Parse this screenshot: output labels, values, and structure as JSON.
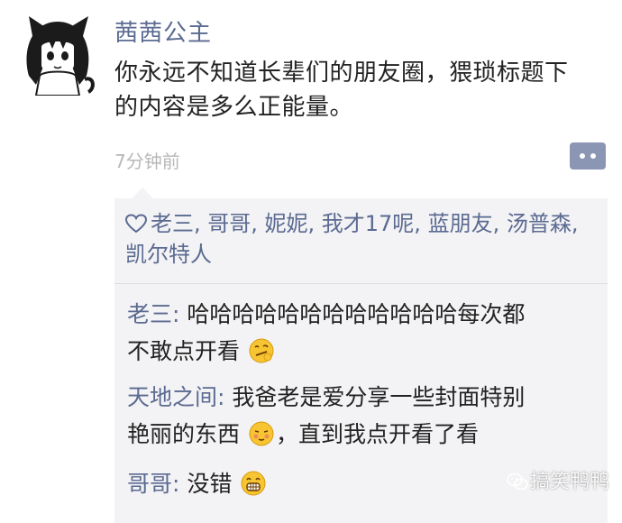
{
  "post": {
    "author": "茜茜公主",
    "text_line1": "你永远不知道长辈们的朋友圈，猥琐标题下",
    "text_line2": "的内容是多么正能量。",
    "time": "7分钟前"
  },
  "likes": {
    "icon": "heart-outline-icon",
    "names": "老三, 哥哥, 妮妮, 我才17呢, 蓝朋友, 汤普森, 凯尔特人"
  },
  "comments": [
    {
      "author": "老三",
      "separator": ": ",
      "line1": "哈哈哈哈哈哈哈哈哈哈哈哈每次都",
      "line2": "不敢点开看",
      "emoji": "smirk-face-emoji"
    },
    {
      "author": "天地之间",
      "separator": ": ",
      "line1": "我爸老是爱分享一些封面特别",
      "line2a": "艳丽的东西",
      "emoji": "shy-face-emoji",
      "line2b": "，直到我点开看了看"
    },
    {
      "author": "哥哥",
      "separator": ": ",
      "text": "没错",
      "emoji": "grin-face-emoji"
    }
  ],
  "watermark": {
    "icon": "wechat-icon",
    "text": "搞笑鸭鸭"
  },
  "colors": {
    "name_blue": "#5b6a91",
    "comment_bg": "#f3f3f5",
    "time_gray": "#b8b8b8",
    "emoji_yellow": "#f7c531"
  }
}
